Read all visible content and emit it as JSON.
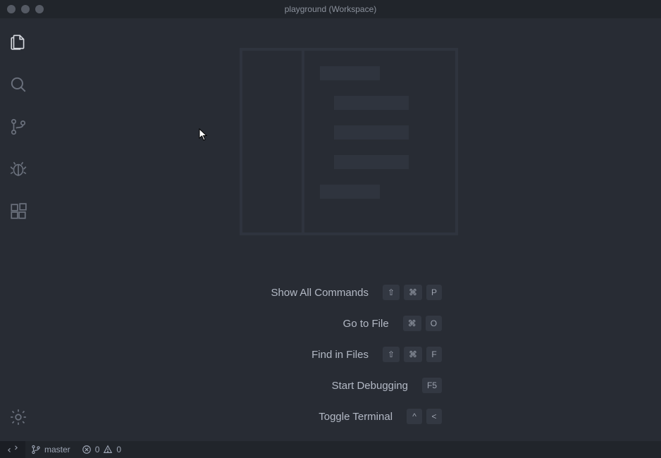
{
  "window": {
    "title": "playground (Workspace)"
  },
  "commands": [
    {
      "label": "Show All Commands",
      "keys": [
        "⇧",
        "⌘",
        "P"
      ]
    },
    {
      "label": "Go to File",
      "keys": [
        "⌘",
        "O"
      ]
    },
    {
      "label": "Find in Files",
      "keys": [
        "⇧",
        "⌘",
        "F"
      ]
    },
    {
      "label": "Start Debugging",
      "keys": [
        "F5"
      ]
    },
    {
      "label": "Toggle Terminal",
      "keys": [
        "^",
        "<"
      ]
    }
  ],
  "statusbar": {
    "branch": "master",
    "errors": "0",
    "warnings": "0"
  }
}
